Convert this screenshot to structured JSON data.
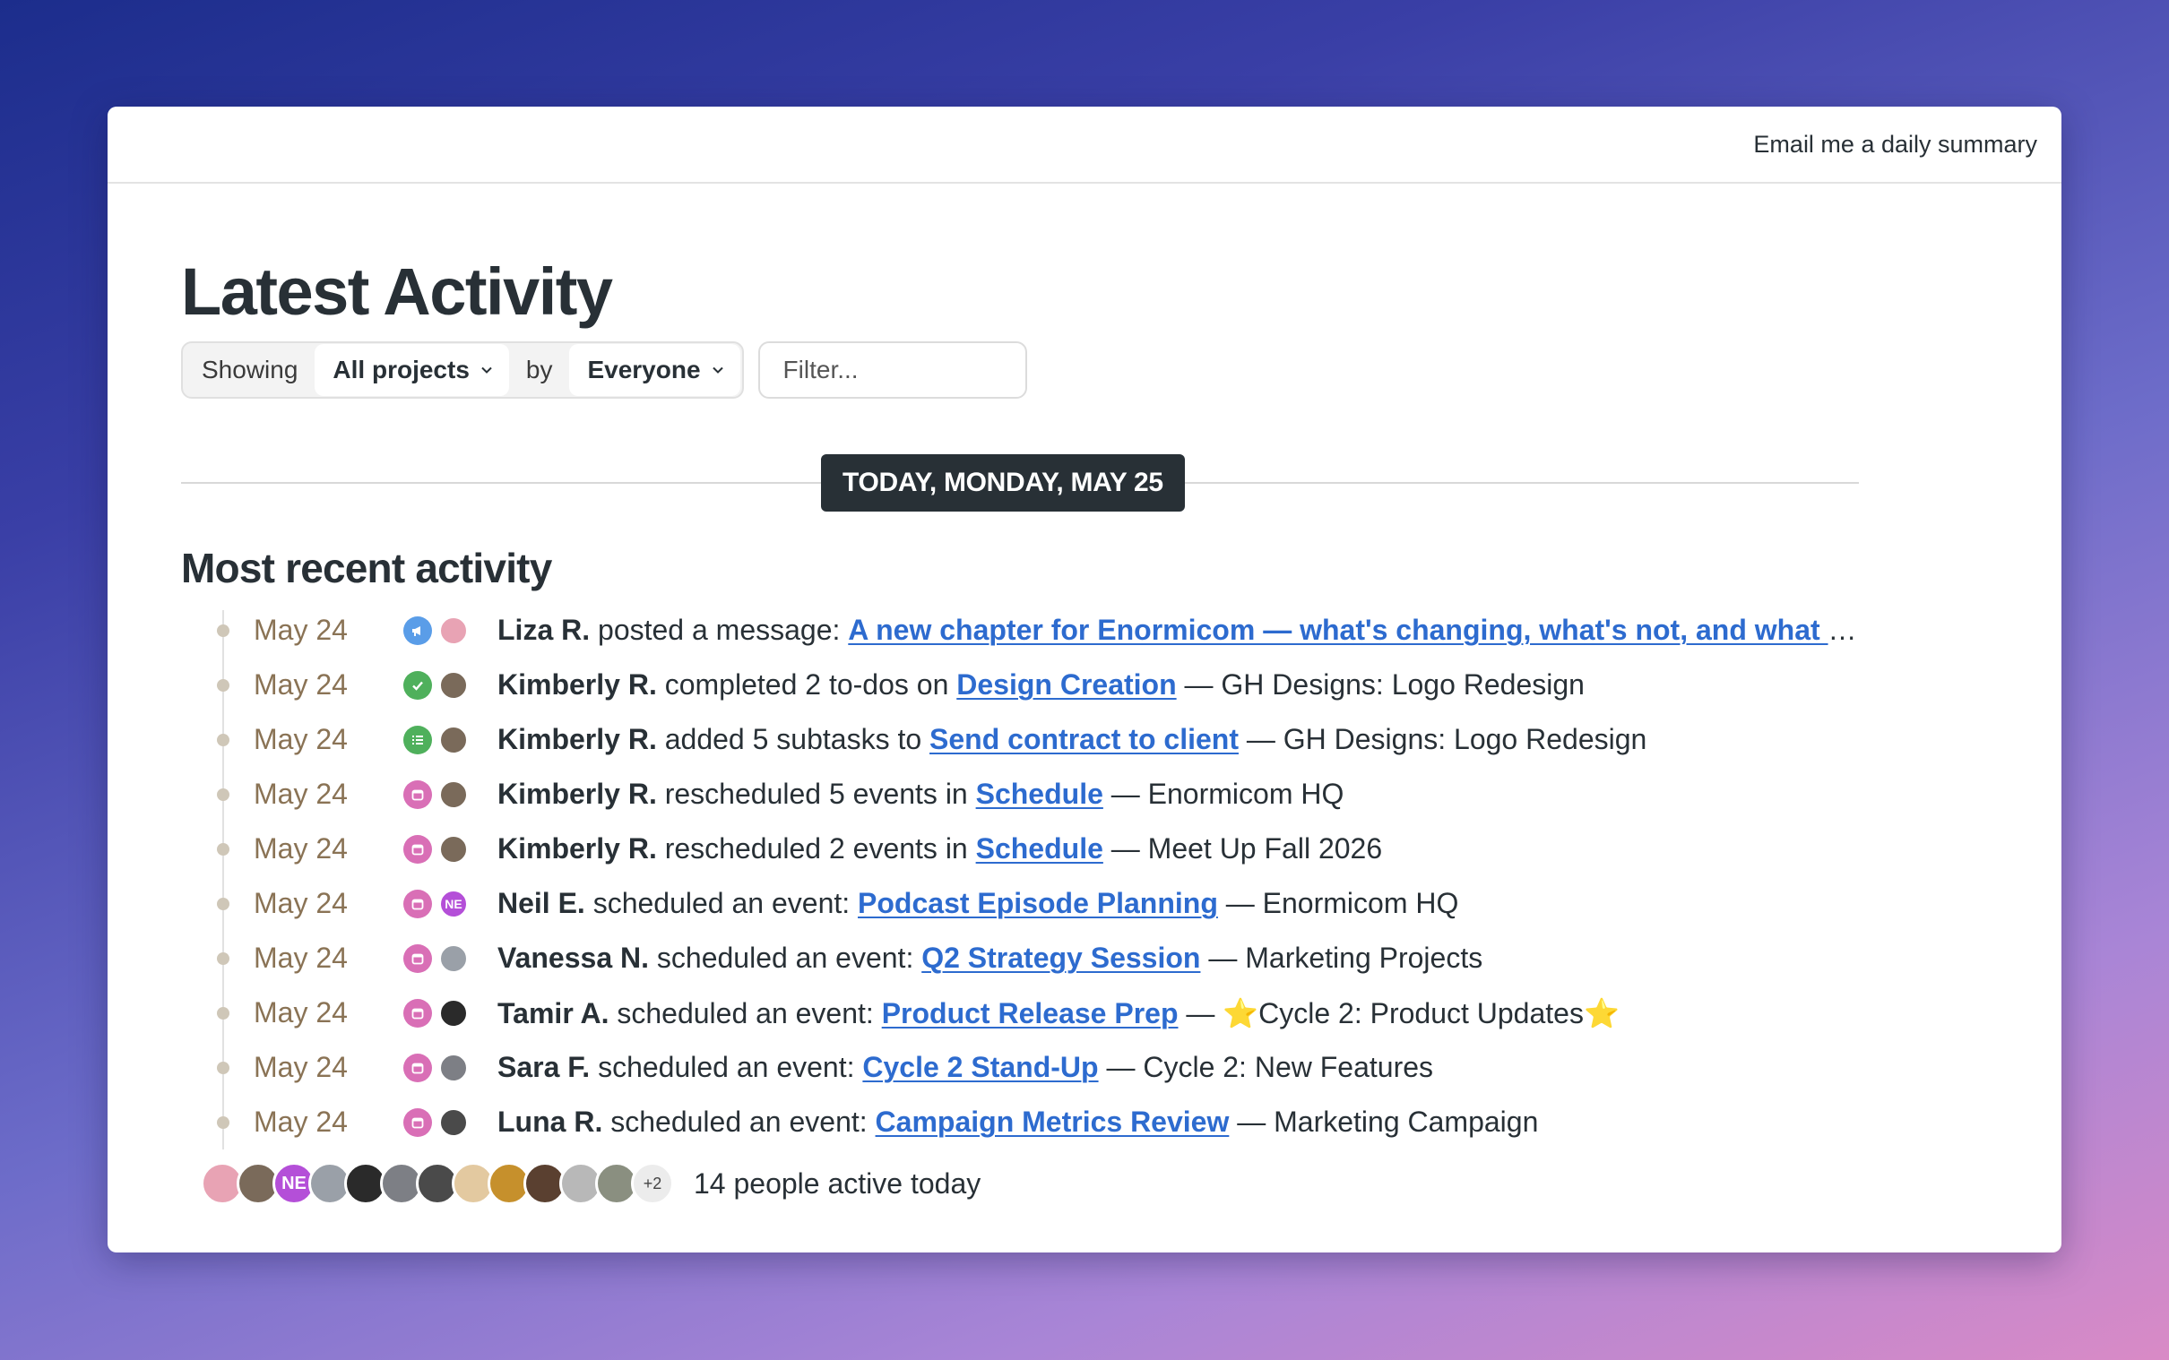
{
  "header": {
    "email_link": "Email me a daily summary"
  },
  "page_title": "Latest Activity",
  "filters": {
    "showing_label": "Showing",
    "projects_value": "All projects",
    "by_label": "by",
    "people_value": "Everyone",
    "filter_placeholder": "Filter..."
  },
  "date_badge": "TODAY, MONDAY, MAY 25",
  "section_title": "Most recent activity",
  "activities": [
    {
      "date": "May 24",
      "type_icon": "megaphone-icon",
      "type_color": "#5a9de8",
      "avatar_color": "#e8a3b4",
      "avatar_initials": "",
      "who": "Liza R.",
      "action": " posted a message: ",
      "link": "A new chapter for Enormicom — what's changing, what's not, and what comes next",
      "context": ""
    },
    {
      "date": "May 24",
      "type_icon": "check-icon",
      "type_color": "#4fb05c",
      "avatar_color": "#7a6a5a",
      "avatar_initials": "",
      "who": "Kimberly R.",
      "action": " completed 2 to-dos on ",
      "link": "Design Creation",
      "context": " — GH Designs: Logo Redesign"
    },
    {
      "date": "May 24",
      "type_icon": "list-icon",
      "type_color": "#4fb05c",
      "avatar_color": "#7a6a5a",
      "avatar_initials": "",
      "who": "Kimberly R.",
      "action": " added 5 subtasks to ",
      "link": "Send contract to client",
      "context": " — GH Designs: Logo Redesign"
    },
    {
      "date": "May 24",
      "type_icon": "calendar-icon",
      "type_color": "#d96fb6",
      "avatar_color": "#7a6a5a",
      "avatar_initials": "",
      "who": "Kimberly R.",
      "action": " rescheduled 5 events in ",
      "link": "Schedule",
      "context": " — Enormicom HQ"
    },
    {
      "date": "May 24",
      "type_icon": "calendar-icon",
      "type_color": "#d96fb6",
      "avatar_color": "#7a6a5a",
      "avatar_initials": "",
      "who": "Kimberly R.",
      "action": " rescheduled 2 events in ",
      "link": "Schedule",
      "context": " — Meet Up Fall 2026"
    },
    {
      "date": "May 24",
      "type_icon": "calendar-icon",
      "type_color": "#d96fb6",
      "avatar_color": "#b44fd8",
      "avatar_initials": "NE",
      "who": "Neil E.",
      "action": " scheduled an event: ",
      "link": "Podcast Episode Planning",
      "context": " — Enormicom HQ"
    },
    {
      "date": "May 24",
      "type_icon": "calendar-icon",
      "type_color": "#d96fb6",
      "avatar_color": "#9aa0a8",
      "avatar_initials": "",
      "who": "Vanessa N.",
      "action": " scheduled an event: ",
      "link": "Q2 Strategy Session",
      "context": " — Marketing Projects"
    },
    {
      "date": "May 24",
      "type_icon": "calendar-icon",
      "type_color": "#d96fb6",
      "avatar_color": "#2a2a2a",
      "avatar_initials": "",
      "who": "Tamir A.",
      "action": " scheduled an event: ",
      "link": "Product Release Prep",
      "context": " — ⭐Cycle 2: Product Updates⭐"
    },
    {
      "date": "May 24",
      "type_icon": "calendar-icon",
      "type_color": "#d96fb6",
      "avatar_color": "#7d7f85",
      "avatar_initials": "",
      "who": "Sara F.",
      "action": " scheduled an event: ",
      "link": "Cycle 2 Stand-Up",
      "context": " — Cycle 2: New Features"
    },
    {
      "date": "May 24",
      "type_icon": "calendar-icon",
      "type_color": "#d96fb6",
      "avatar_color": "#4a4a4a",
      "avatar_initials": "",
      "who": "Luna R.",
      "action": " scheduled an event: ",
      "link": "Campaign Metrics Review",
      "context": " — Marketing Campaign"
    }
  ],
  "active_people": {
    "avatars": [
      {
        "color": "#e8a3b4",
        "initials": ""
      },
      {
        "color": "#7a6a5a",
        "initials": ""
      },
      {
        "color": "#b44fd8",
        "initials": "NE"
      },
      {
        "color": "#9aa0a8",
        "initials": ""
      },
      {
        "color": "#2a2a2a",
        "initials": ""
      },
      {
        "color": "#7d7f85",
        "initials": ""
      },
      {
        "color": "#4a4a4a",
        "initials": ""
      },
      {
        "color": "#e3c9a0",
        "initials": ""
      },
      {
        "color": "#c6902c",
        "initials": ""
      },
      {
        "color": "#5a4030",
        "initials": ""
      },
      {
        "color": "#b8b8b8",
        "initials": ""
      },
      {
        "color": "#8a8f80",
        "initials": ""
      }
    ],
    "more_count": "+2",
    "summary": "14 people active today"
  }
}
